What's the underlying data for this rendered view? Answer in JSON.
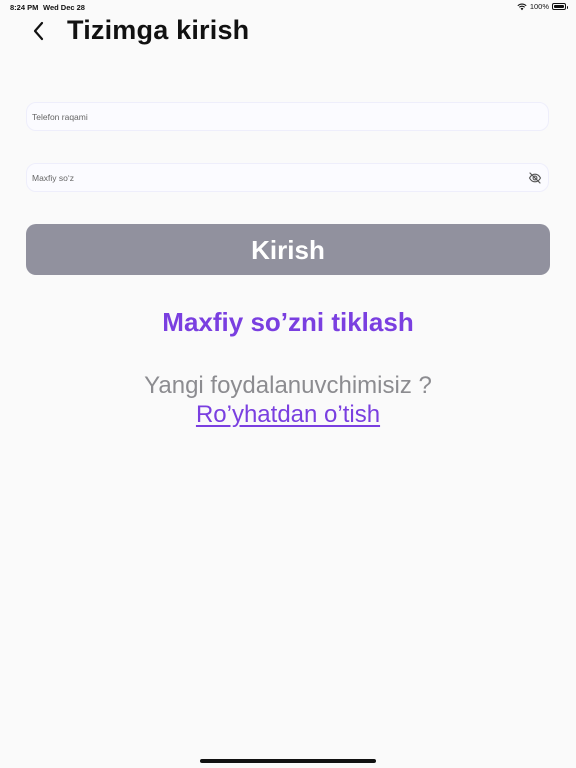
{
  "status_bar": {
    "time": "8:24 PM",
    "date": "Wed Dec 28",
    "battery": "100%"
  },
  "header": {
    "title": "Tizimga kirish"
  },
  "form": {
    "phone_placeholder": "Telefon raqami",
    "password_placeholder": "Maxfiy so‘z"
  },
  "actions": {
    "login_label": "Kirish",
    "forgot_label": "Maxfiy so’zni tiklash",
    "new_user_text": "Yangi foydalanuvchimisiz ?",
    "register_label": "Ro’yhatdan o’tish"
  },
  "icons": {
    "back": "chevron-left-icon",
    "eye": "eye-off-icon",
    "wifi": "wifi-icon",
    "battery": "battery-icon"
  },
  "colors": {
    "accent": "#7a3fe0",
    "button_disabled": "#91919e",
    "secondary_text": "#8c8c90",
    "background": "#fafafa"
  }
}
